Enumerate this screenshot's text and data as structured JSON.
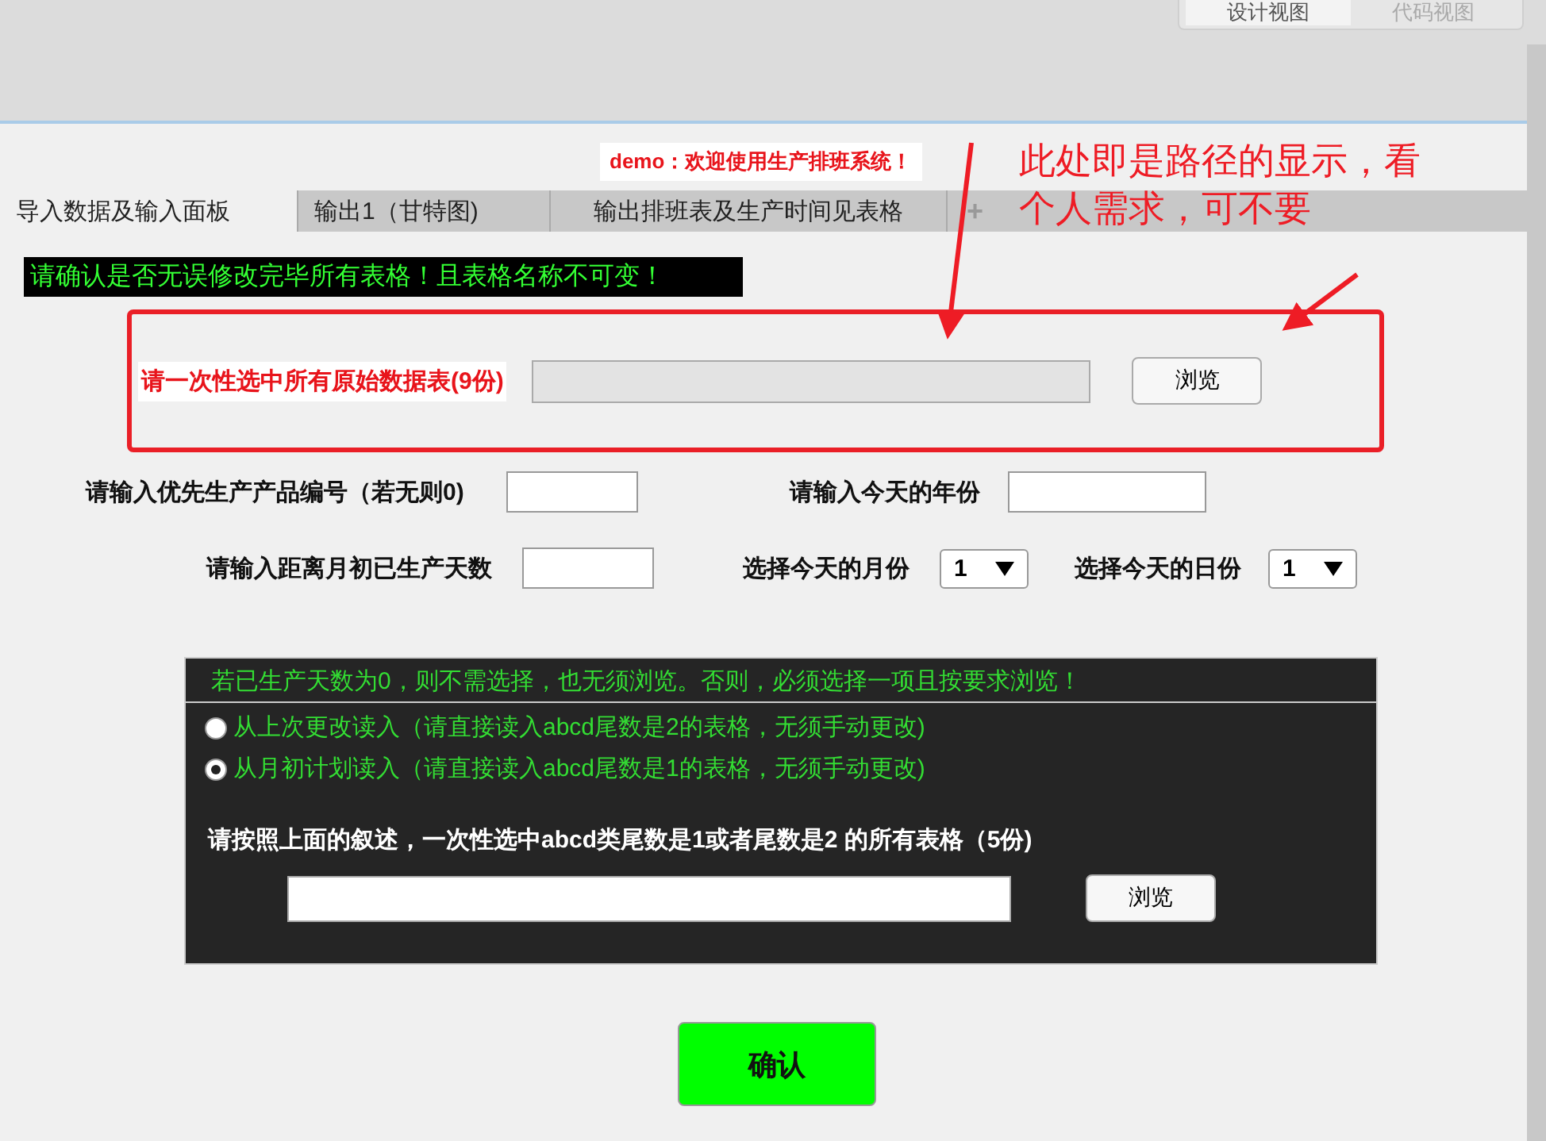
{
  "view_switch": [
    {
      "label": "设计视图",
      "selected": true
    },
    {
      "label": "代码视图",
      "selected": false
    }
  ],
  "banner": "demo：欢迎使用生产排班系统！",
  "tabs": [
    {
      "label": "导入数据及输入面板",
      "selected": true
    },
    {
      "label": "输出1（甘特图)",
      "selected": false
    },
    {
      "label": "输出排班表及生产时间见表格",
      "selected": false
    }
  ],
  "add_tab": "+",
  "warning": "请确认是否无误修改完毕所有表格！且表格名称不可变！",
  "source_files": {
    "label": "请一次性选中所有原始数据表(9份)",
    "browse": "浏览"
  },
  "priority_product": {
    "label": "请输入优先生产产品编号（若无则0)"
  },
  "year": {
    "label": "请输入今天的年份"
  },
  "produced_days": {
    "label": "请输入距离月初已生产天数"
  },
  "month": {
    "label": "选择今天的月份",
    "value": "1"
  },
  "day": {
    "label": "选择今天的日份",
    "value": "1"
  },
  "read_mode": {
    "note": "若已生产天数为0，则不需选择，也无须浏览。否则，必须选择一项且按要求浏览！",
    "options": [
      {
        "label": "从上次更改读入（请直接读入abcd尾数是2的表格，无须手动更改)",
        "selected": false
      },
      {
        "label": "从月初计划读入（请直接读入abcd尾数是1的表格，无须手动更改)",
        "selected": true
      }
    ],
    "instruction": "请按照上面的叙述，一次性选中abcd类尾数是1或者尾数是2 的所有表格（5份)",
    "browse": "浏览"
  },
  "confirm": "确认",
  "annotation": "此处即是路径的显示，看个人需求，可不要"
}
